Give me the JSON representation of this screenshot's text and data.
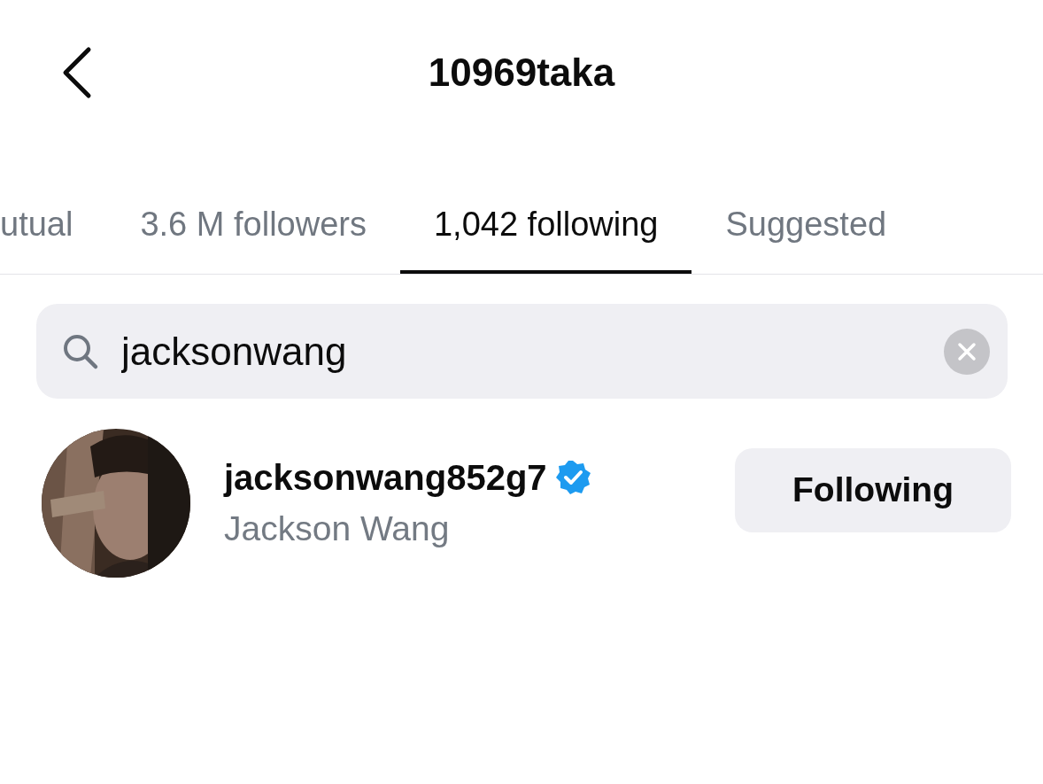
{
  "header": {
    "title": "10969taka"
  },
  "tabs": [
    {
      "label": "utual",
      "selected": false
    },
    {
      "label": "3.6 M followers",
      "selected": false
    },
    {
      "label": "1,042 following",
      "selected": true
    },
    {
      "label": "Suggested",
      "selected": false
    }
  ],
  "search": {
    "value": "jacksonwang"
  },
  "results": [
    {
      "username": "jacksonwang852g7",
      "verified": true,
      "full_name": "Jackson Wang",
      "button": "Following"
    }
  ]
}
